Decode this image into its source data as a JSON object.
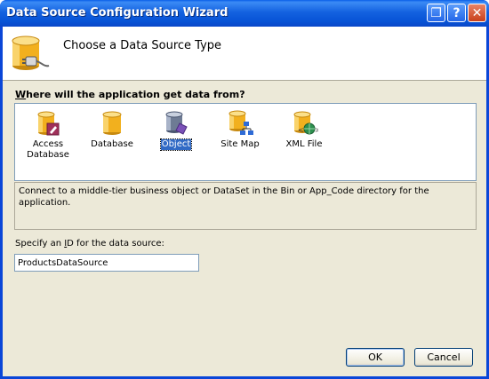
{
  "window": {
    "title": "Data Source Configuration Wizard",
    "controls": {
      "restore": "❐",
      "help": "?",
      "close": "✕"
    }
  },
  "header": {
    "title": "Choose a Data Source Type",
    "icon": "database-plug-icon"
  },
  "question": {
    "prefix": "W",
    "rest": "here will the application get data from?"
  },
  "types": [
    {
      "label_line1": "Access",
      "label_line2": "Database",
      "icon": "access-database-icon",
      "selected": false
    },
    {
      "label_line1": "Database",
      "label_line2": "",
      "icon": "database-icon",
      "selected": false
    },
    {
      "label_line1": "Object",
      "label_line2": "",
      "icon": "object-icon",
      "selected": true
    },
    {
      "label_line1": "Site Map",
      "label_line2": "",
      "icon": "site-map-icon",
      "selected": false
    },
    {
      "label_line1": "XML File",
      "label_line2": "",
      "icon": "xml-file-icon",
      "selected": false
    }
  ],
  "description": "Connect to a middle-tier business object or DataSet in the Bin or App_Code directory for the application.",
  "id_field": {
    "label_prefix": "Specify an ",
    "label_mnemonic": "I",
    "label_rest": "D for the data source:",
    "value": "ProductsDataSource"
  },
  "buttons": {
    "ok": "OK",
    "cancel": "Cancel"
  },
  "colors": {
    "titlebar": "#0a5fe8",
    "client": "#ece9d8",
    "selection": "#316ac5",
    "db_gold": "#f2b01e"
  }
}
